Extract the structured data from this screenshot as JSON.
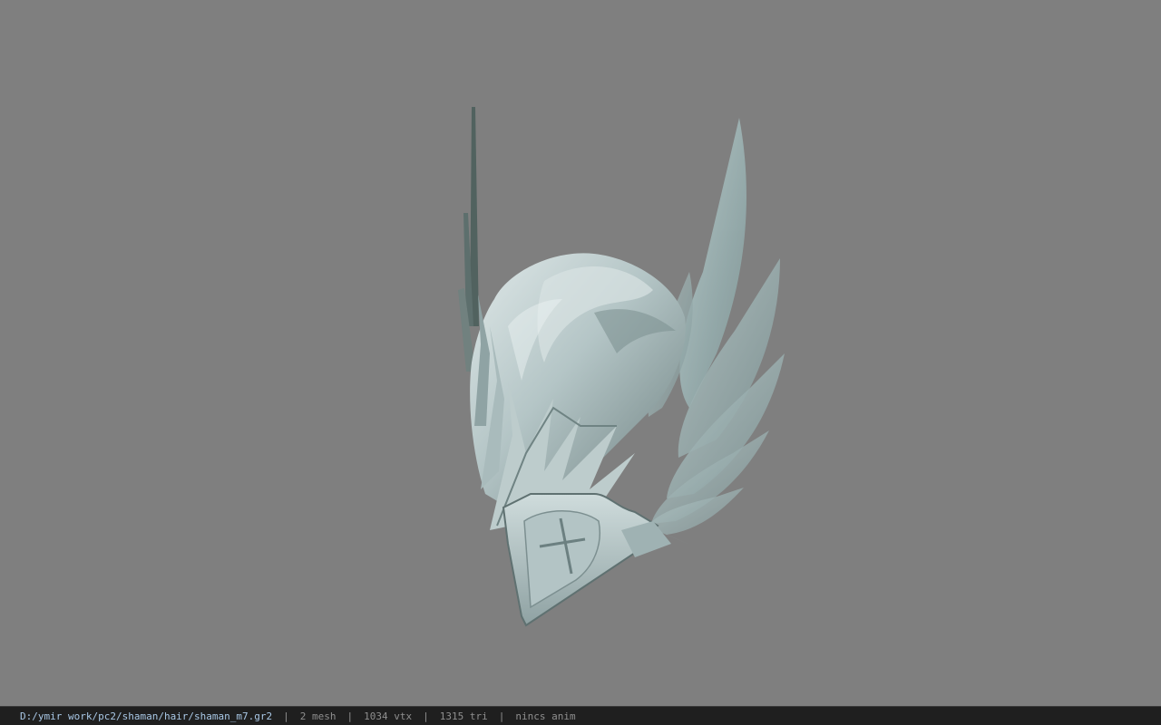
{
  "viewer": {
    "background_color": "#7f7f7f",
    "model_icon": "helmet-model"
  },
  "statusbar": {
    "file_path": "D:/ymir work/pc2/shaman/hair/shaman_m7.gr2",
    "separator": "|",
    "mesh_count": "2 mesh",
    "vertex_count": "1034 vtx",
    "triangle_count": "1315 tri",
    "anim_status": "nincs anim"
  },
  "colors": {
    "statusbar_bg": "#1f1f1f",
    "path_text": "#a9c8e6",
    "stat_text": "#8f8f8f",
    "metal_light": "#c9d6d6",
    "metal_mid": "#a7b9ba",
    "metal_dark": "#5f7171",
    "feather": "#9fb6b8"
  }
}
